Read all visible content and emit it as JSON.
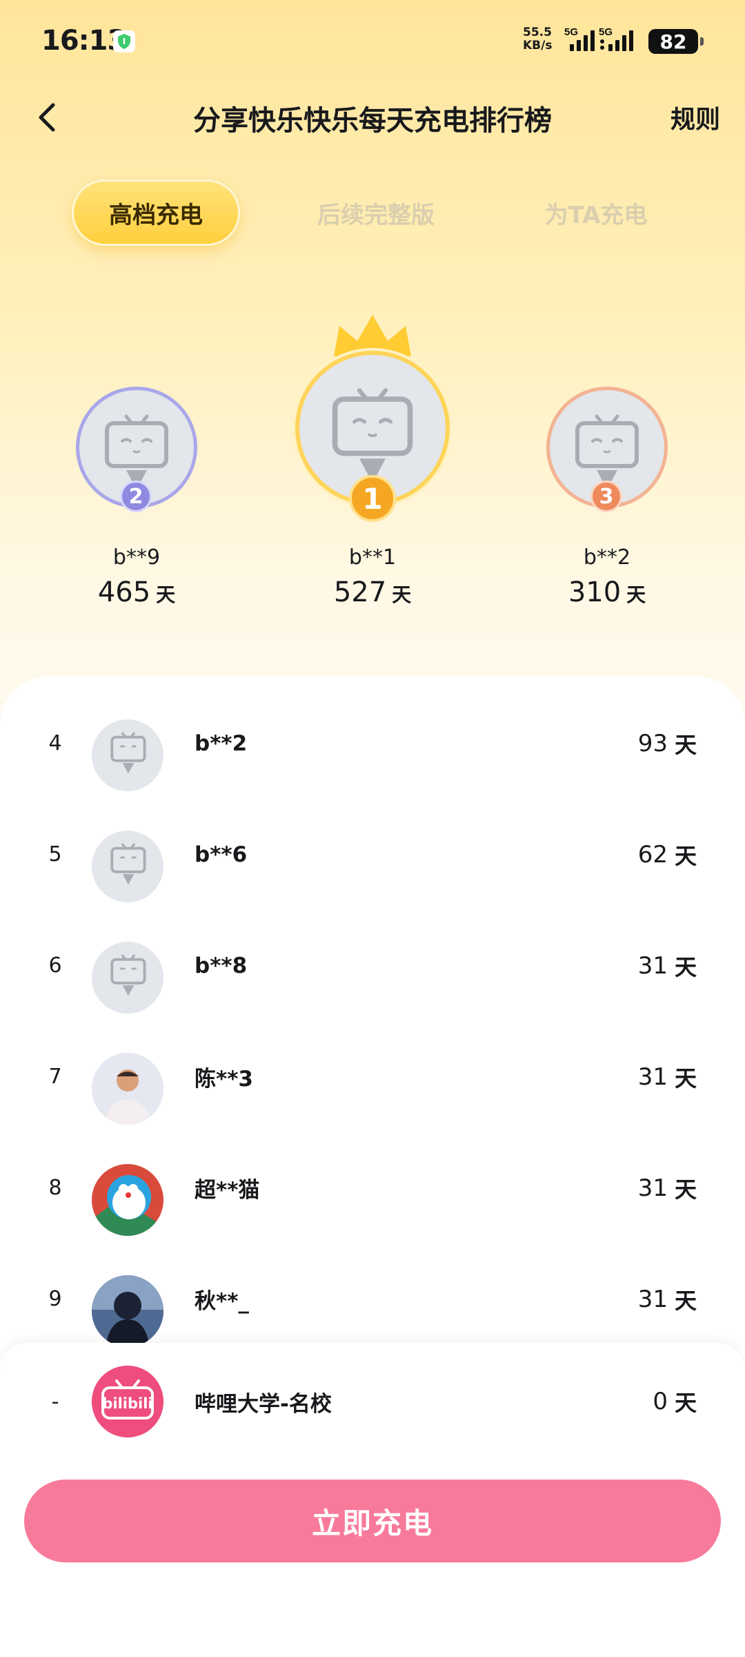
{
  "status_bar": {
    "time": "16:13",
    "net_speed_value": "55.5",
    "net_speed_unit": "KB/s",
    "network_1": "5G",
    "network_2": "5G",
    "battery": "82"
  },
  "header": {
    "title": "分享快乐快乐每天充电排行榜",
    "rules_label": "规则",
    "back_icon": "chevron-left-icon"
  },
  "tabs": [
    {
      "label": "高档充电",
      "active": true
    },
    {
      "label": "后续完整版",
      "active": false
    },
    {
      "label": "为TA充电",
      "active": false
    }
  ],
  "podium": [
    {
      "rank": "2",
      "name": "b**9",
      "days": "465",
      "unit": "天",
      "ring_color": "#a9a7ea",
      "medal_color": "#8f8ae0"
    },
    {
      "rank": "1",
      "name": "b**1",
      "days": "527",
      "unit": "天",
      "ring_color": "#ffd45a",
      "medal_color": "#f5a623"
    },
    {
      "rank": "3",
      "name": "b**2",
      "days": "310",
      "unit": "天",
      "ring_color": "#f3b392",
      "medal_color": "#ee8a5c"
    }
  ],
  "list": [
    {
      "rank": "4",
      "name": "b**2",
      "days": "93",
      "unit": "天",
      "avatar": "default-tv-avatar"
    },
    {
      "rank": "5",
      "name": "b**6",
      "days": "62",
      "unit": "天",
      "avatar": "default-tv-avatar"
    },
    {
      "rank": "6",
      "name": "b**8",
      "days": "31",
      "unit": "天",
      "avatar": "default-tv-avatar"
    },
    {
      "rank": "7",
      "name": "陈**3",
      "days": "31",
      "unit": "天",
      "avatar": "photo-man"
    },
    {
      "rank": "8",
      "name": "超**猫",
      "days": "31",
      "unit": "天",
      "avatar": "doraemon"
    },
    {
      "rank": "9",
      "name": "秋**_",
      "days": "31",
      "unit": "天",
      "avatar": "anime-boy"
    }
  ],
  "self": {
    "rank": "-",
    "name": "哔哩大学-名校",
    "days": "0",
    "unit": "天",
    "avatar_text": "bilibili"
  },
  "cta_label": "立即充电",
  "colors": {
    "accent_pink": "#f87a9b",
    "tab_active": "#ffd44a",
    "tab_inactive_text": "#d9cfae"
  }
}
